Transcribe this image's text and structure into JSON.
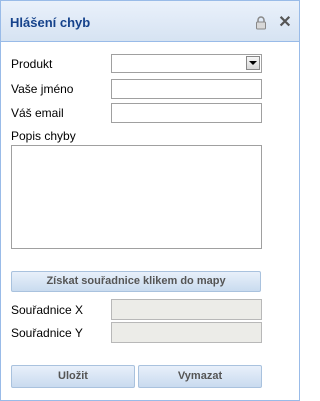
{
  "header": {
    "title": "Hlášení chyb"
  },
  "form": {
    "product_label": "Produkt",
    "product_value": "",
    "name_label": "Vaše jméno",
    "name_value": "",
    "email_label": "Váš email",
    "email_value": "",
    "description_label": "Popis chyby",
    "description_value": "",
    "get_coords_button": "Získat souřadnice klikem do mapy",
    "coord_x_label": "Souřadnice X",
    "coord_x_value": "",
    "coord_y_label": "Souřadnice Y",
    "coord_y_value": ""
  },
  "actions": {
    "save": "Uložit",
    "clear": "Vymazat"
  },
  "colors": {
    "title": "#15428b",
    "border": "#99bbe8",
    "readonly_bg": "#ecece8"
  },
  "icons": [
    "lock-icon",
    "close-icon",
    "dropdown-arrow-icon"
  ]
}
